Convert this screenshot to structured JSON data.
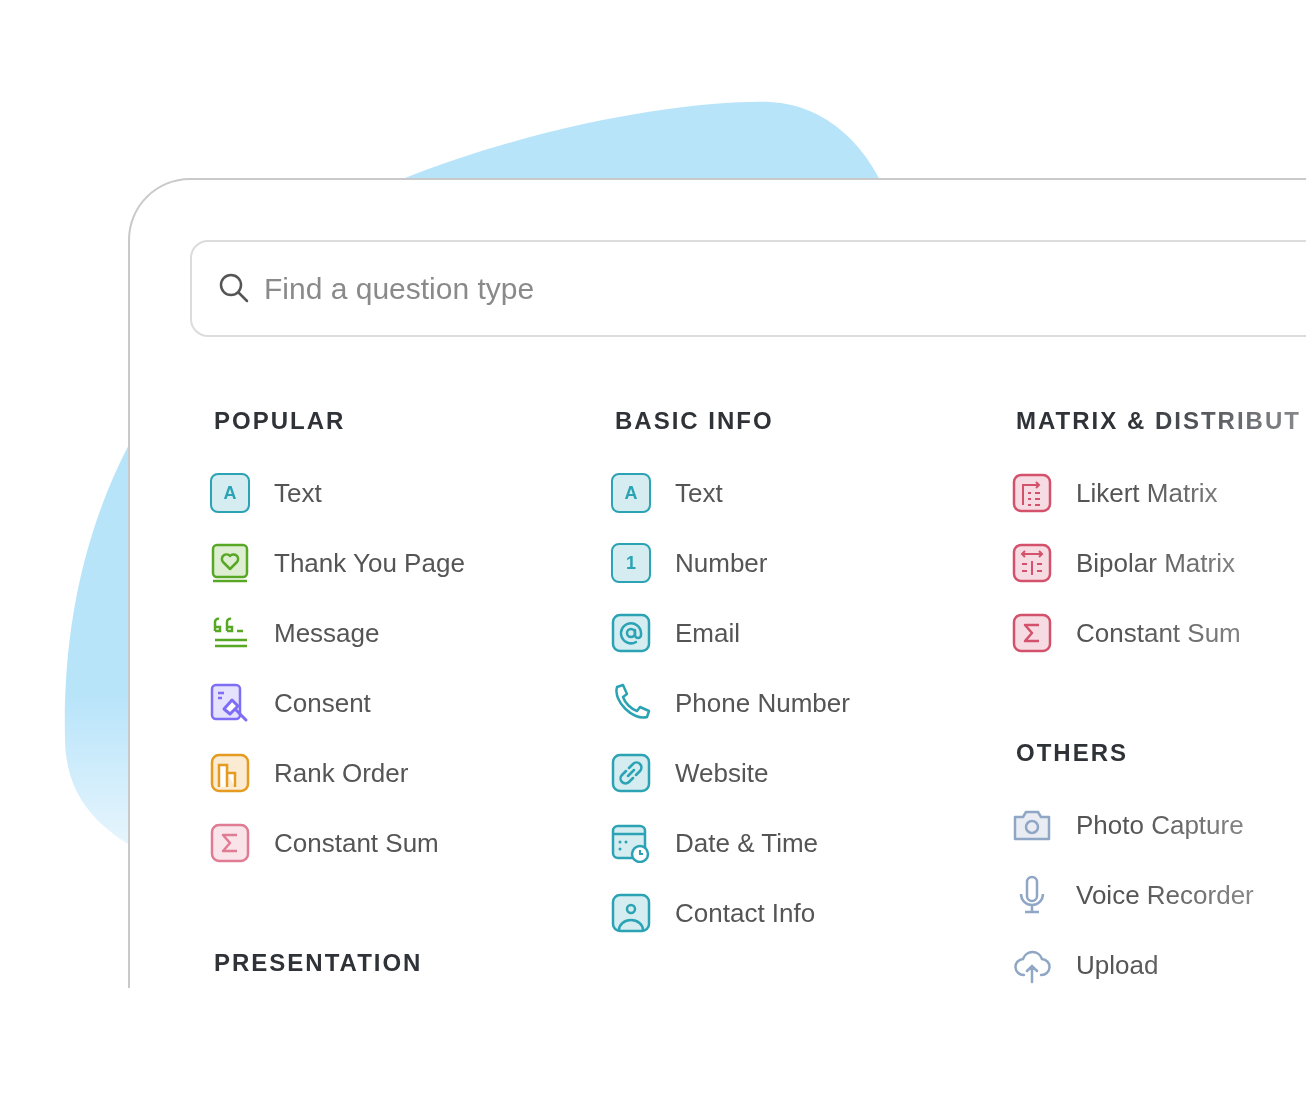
{
  "search": {
    "placeholder": "Find a question type"
  },
  "columns": [
    [
      {
        "heading": "POPULAR",
        "items": [
          {
            "label": "Text",
            "kind": "glyph",
            "glyph": "A",
            "color": "#2ba3b4"
          },
          {
            "label": "Thank You Page",
            "kind": "heart",
            "color": "#58a825"
          },
          {
            "label": "Message",
            "kind": "quote",
            "color": "#58a825"
          },
          {
            "label": "Consent",
            "kind": "consent",
            "color": "#7d6ef5"
          },
          {
            "label": "Rank Order",
            "kind": "rank",
            "color": "#e49b1f"
          },
          {
            "label": "Constant Sum",
            "kind": "sum",
            "color": "#e07b93"
          }
        ]
      },
      {
        "heading": "PRESENTATION"
      }
    ],
    [
      {
        "heading": "BASIC INFO",
        "items": [
          {
            "label": "Text",
            "kind": "glyph",
            "glyph": "A",
            "color": "#2ba3b4"
          },
          {
            "label": "Number",
            "kind": "glyph",
            "glyph": "1",
            "color": "#2ba3b4"
          },
          {
            "label": "Email",
            "kind": "at",
            "color": "#2ba3b4"
          },
          {
            "label": "Phone Number",
            "kind": "phone",
            "color": "#2ba3b4"
          },
          {
            "label": "Website",
            "kind": "link",
            "color": "#2ba3b4"
          },
          {
            "label": "Date & Time",
            "kind": "calendar",
            "color": "#2ba3b4"
          },
          {
            "label": "Contact Info",
            "kind": "contact",
            "color": "#2ba3b4"
          }
        ]
      }
    ],
    [
      {
        "heading": "MATRIX & DISTRIBUT",
        "items": [
          {
            "label": "Likert Matrix",
            "kind": "likert",
            "color": "#d4516c"
          },
          {
            "label": "Bipolar Matrix",
            "kind": "bipolar",
            "color": "#d4516c"
          },
          {
            "label": "Constant Sum",
            "kind": "sum",
            "color": "#d4516c"
          }
        ]
      },
      {
        "heading": "OTHERS",
        "items": [
          {
            "label": "Photo Capture",
            "kind": "camera",
            "color": "#8fa6c4"
          },
          {
            "label": "Voice Recorder",
            "kind": "mic",
            "color": "#8fa6c4"
          },
          {
            "label": "Upload",
            "kind": "upload",
            "color": "#8fa6c4"
          }
        ]
      }
    ]
  ]
}
